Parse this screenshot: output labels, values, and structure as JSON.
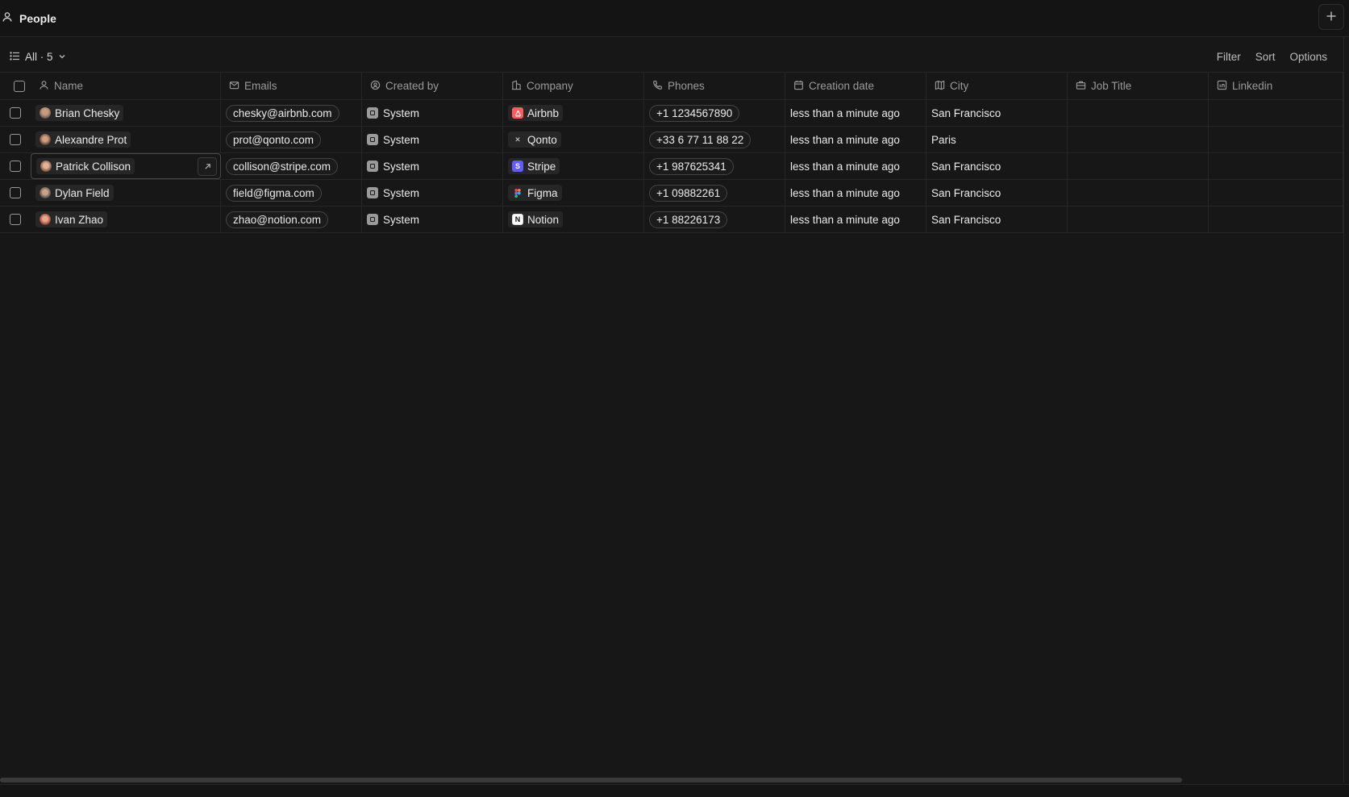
{
  "topbar": {
    "title": "People",
    "icon": "person-icon",
    "add_icon": "plus-icon"
  },
  "view": {
    "label": "All · 5",
    "actions": {
      "filter": "Filter",
      "sort": "Sort",
      "options": "Options"
    }
  },
  "columns": {
    "name": "Name",
    "emails": "Emails",
    "created_by": "Created by",
    "company": "Company",
    "phones": "Phones",
    "creation_date": "Creation date",
    "city": "City",
    "job_title": "Job Title",
    "linkedin": "Linkedin"
  },
  "rows": [
    {
      "name": "Brian Chesky",
      "email": "chesky@airbnb.com",
      "created_by": "System",
      "company": "Airbnb",
      "phone": "+1 1234567890",
      "date": "less than a minute ago",
      "city": "San Francisco",
      "job": "",
      "linkedin": ""
    },
    {
      "name": "Alexandre Prot",
      "email": "prot@qonto.com",
      "created_by": "System",
      "company": "Qonto",
      "phone": "+33 6 77 11 88 22",
      "date": "less than a minute ago",
      "city": "Paris",
      "job": "",
      "linkedin": ""
    },
    {
      "name": "Patrick Collison",
      "email": "collison@stripe.com",
      "created_by": "System",
      "company": "Stripe",
      "phone": "+1 987625341",
      "date": "less than a minute ago",
      "city": "San Francisco",
      "job": "",
      "linkedin": ""
    },
    {
      "name": "Dylan Field",
      "email": "field@figma.com",
      "created_by": "System",
      "company": "Figma",
      "phone": "+1 09882261",
      "date": "less than a minute ago",
      "city": "San Francisco",
      "job": "",
      "linkedin": ""
    },
    {
      "name": "Ivan Zhao",
      "email": "zhao@notion.com",
      "created_by": "System",
      "company": "Notion",
      "phone": "+1 88226173",
      "date": "less than a minute ago",
      "city": "San Francisco",
      "job": "",
      "linkedin": ""
    }
  ],
  "colors": {
    "background": "#171717",
    "border": "#262626",
    "text": "#ebebeb",
    "muted": "#9a9a9a",
    "airbnb": "#ff5a5f",
    "stripe": "#635bff"
  }
}
